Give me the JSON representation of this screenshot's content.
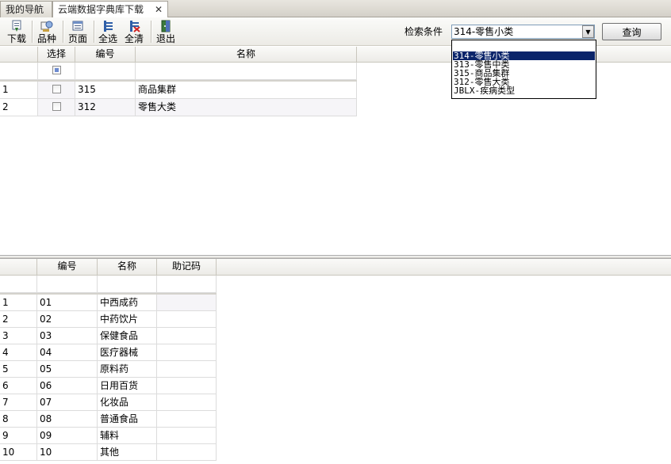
{
  "tabs": [
    {
      "label": "我的导航",
      "active": false
    },
    {
      "label": "云端数据字典库下载",
      "active": true,
      "close": "✕"
    }
  ],
  "toolbar": {
    "buttons": [
      {
        "label": "下载",
        "icon": "download-icon"
      },
      {
        "label": "品种",
        "icon": "variety-icon"
      },
      {
        "label": "页面",
        "icon": "page-icon"
      },
      {
        "label": "全选",
        "icon": "select-all-icon"
      },
      {
        "label": "全清",
        "icon": "clear-all-icon"
      },
      {
        "label": "退出",
        "icon": "exit-icon"
      }
    ],
    "search_label": "检索条件",
    "combo_value": "314-零售小类",
    "query_label": "查询"
  },
  "dropdown": {
    "options": [
      "314-零售小类",
      "313-零售中类",
      "315-商品集群",
      "312-零售大类",
      "JBLX-疾病类型"
    ],
    "selected_index": 0
  },
  "top_grid": {
    "headers": {
      "select": "选择",
      "code": "编号",
      "name": "名称"
    },
    "rows": [
      {
        "num": "1",
        "checked": false,
        "code": "315",
        "name": "商品集群"
      },
      {
        "num": "2",
        "checked": false,
        "code": "312",
        "name": "零售大类"
      }
    ]
  },
  "bottom_grid": {
    "headers": {
      "code": "编号",
      "name": "名称",
      "mnemonic": "助记码"
    },
    "rows": [
      {
        "num": "1",
        "code": "01",
        "name": "中西成药",
        "mnemonic": ""
      },
      {
        "num": "2",
        "code": "02",
        "name": "中药饮片",
        "mnemonic": ""
      },
      {
        "num": "3",
        "code": "03",
        "name": "保健食品",
        "mnemonic": ""
      },
      {
        "num": "4",
        "code": "04",
        "name": "医疗器械",
        "mnemonic": ""
      },
      {
        "num": "5",
        "code": "05",
        "name": "原料药",
        "mnemonic": ""
      },
      {
        "num": "6",
        "code": "06",
        "name": "日用百货",
        "mnemonic": ""
      },
      {
        "num": "7",
        "code": "07",
        "name": "化妆品",
        "mnemonic": ""
      },
      {
        "num": "8",
        "code": "08",
        "name": "普通食品",
        "mnemonic": ""
      },
      {
        "num": "9",
        "code": "09",
        "name": "辅料",
        "mnemonic": ""
      },
      {
        "num": "10",
        "code": "10",
        "name": "其他",
        "mnemonic": ""
      }
    ]
  }
}
